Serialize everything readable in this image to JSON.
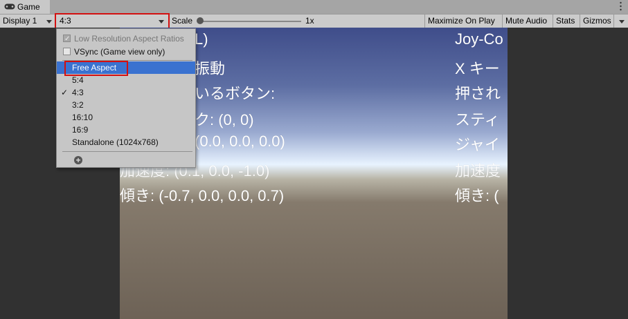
{
  "window": {
    "tab_title": "Game",
    "icon": "gamepad-icon"
  },
  "toolbar": {
    "display": "Display 1",
    "aspect": "4:3",
    "scale_label": "Scale",
    "scale_value": "1x",
    "scale_level": 0,
    "maximize": "Maximize On Play",
    "mute": "Mute Audio",
    "stats": "Stats",
    "gizmos": "Gizmos"
  },
  "menu": {
    "low_res": "Low Resolution Aspect Ratios",
    "vsync": "VSync (Game view only)",
    "items": [
      "Free Aspect",
      "5:4",
      "4:3",
      "3:2",
      "16:10",
      "16:9",
      "Standalone (1024x768)"
    ],
    "checked": "4:3",
    "highlighted": "Free Aspect",
    "check_mark": "✓"
  },
  "game": {
    "left_lines": [
      "L)",
      "振動",
      "いるボタン:",
      "ク:  (0, 0)",
      "  (0.0, 0.0, 0.0)",
      "加速度:  (0.1, 0.0, -1.0)",
      "傾き:  (-0.7, 0.0, 0.0, 0.7)"
    ],
    "right_lines": [
      "Joy-Co",
      "X キー",
      "押され",
      "スティ",
      "ジャイ",
      "加速度",
      "傾き:  ("
    ]
  },
  "colors": {
    "highlight": "#3a72d0",
    "callout": "#d40f0f"
  }
}
